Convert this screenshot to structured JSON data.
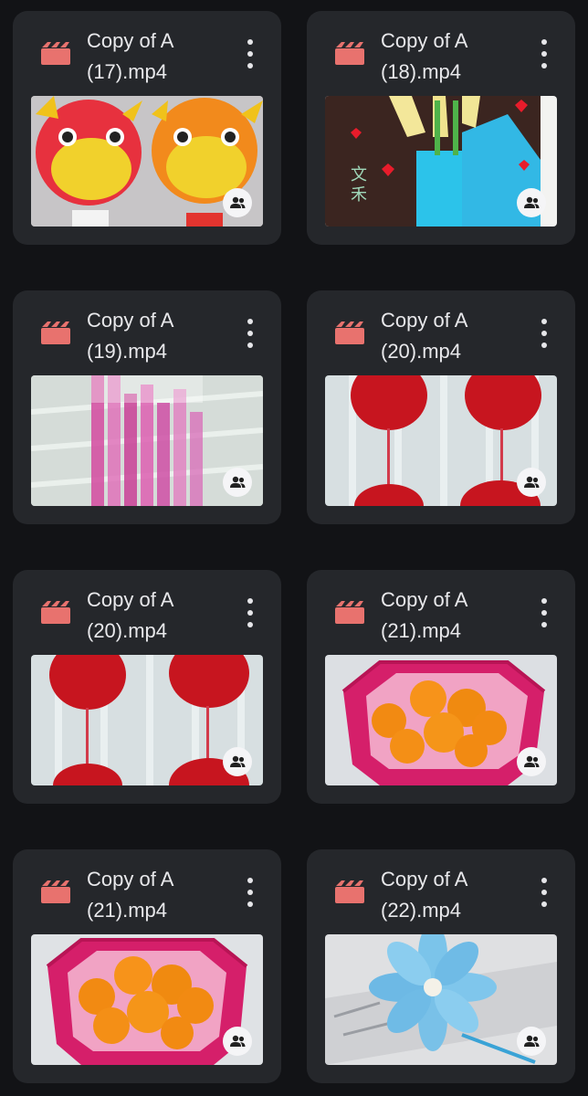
{
  "files": [
    {
      "title_line1": "Copy of A",
      "title_line2": "(17).mp4",
      "file_type_icon": "video-file-icon",
      "menu_icon": "more-vert-icon",
      "shared_icon": "people-icon"
    },
    {
      "title_line1": "Copy of A",
      "title_line2": "(18).mp4",
      "file_type_icon": "video-file-icon",
      "menu_icon": "more-vert-icon",
      "shared_icon": "people-icon"
    },
    {
      "title_line1": "Copy of A",
      "title_line2": "(19).mp4",
      "file_type_icon": "video-file-icon",
      "menu_icon": "more-vert-icon",
      "shared_icon": "people-icon"
    },
    {
      "title_line1": "Copy of A",
      "title_line2": "(20).mp4",
      "file_type_icon": "video-file-icon",
      "menu_icon": "more-vert-icon",
      "shared_icon": "people-icon"
    },
    {
      "title_line1": "Copy of A",
      "title_line2": "(20).mp4",
      "file_type_icon": "video-file-icon",
      "menu_icon": "more-vert-icon",
      "shared_icon": "people-icon"
    },
    {
      "title_line1": "Copy of A",
      "title_line2": "(21).mp4",
      "file_type_icon": "video-file-icon",
      "menu_icon": "more-vert-icon",
      "shared_icon": "people-icon"
    },
    {
      "title_line1": "Copy of A",
      "title_line2": "(21).mp4",
      "file_type_icon": "video-file-icon",
      "menu_icon": "more-vert-icon",
      "shared_icon": "people-icon"
    },
    {
      "title_line1": "Copy of A",
      "title_line2": "(22).mp4",
      "file_type_icon": "video-file-icon",
      "menu_icon": "more-vert-icon",
      "shared_icon": "people-icon"
    }
  ],
  "colors": {
    "background": "#121316",
    "card": "#25272b",
    "video_icon": "#e8726e",
    "text": "#e8e8eb"
  }
}
